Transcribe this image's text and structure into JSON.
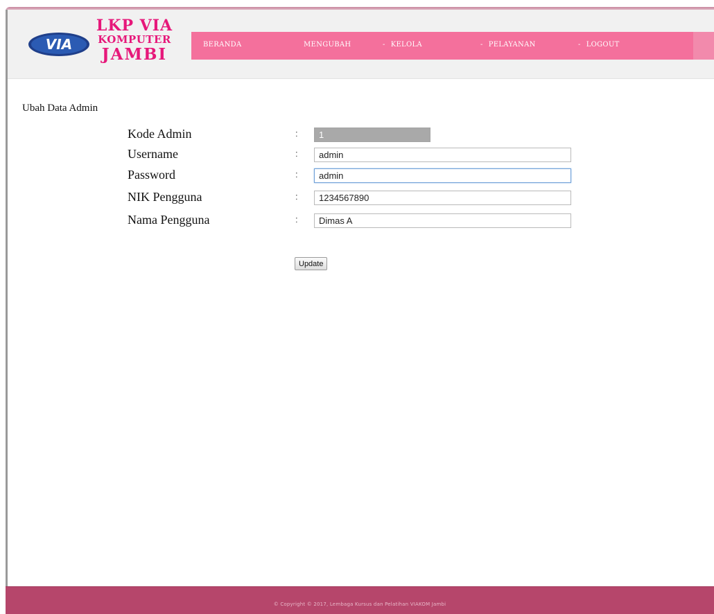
{
  "header": {
    "logo": {
      "badge_text": "VIA",
      "line1": "LKP VIA",
      "line2": "KOMPUTER",
      "line3": "JAMBI",
      "brand_color": "#e6187a"
    },
    "nav": {
      "accent": "#f4709c",
      "items": [
        {
          "label": "BERANDA",
          "caret": ""
        },
        {
          "label": "MENGUBAH",
          "caret": ""
        },
        {
          "label": "KELOLA",
          "caret": "-"
        },
        {
          "label": "PELAYANAN",
          "caret": "-"
        },
        {
          "label": "LOGOUT",
          "caret": "-"
        }
      ]
    }
  },
  "main": {
    "title": "Ubah Data Admin",
    "fields": [
      {
        "label": "Kode Admin",
        "colon": ":",
        "value": "1"
      },
      {
        "label": "Username",
        "colon": ":",
        "value": "admin"
      },
      {
        "label": "Password",
        "colon": ":",
        "value": "admin"
      },
      {
        "label": "NIK Pengguna",
        "colon": ":",
        "value": "1234567890"
      },
      {
        "label": "Nama Pengguna",
        "colon": ":",
        "value": "Dimas A"
      }
    ],
    "update_label": "Update"
  },
  "footer": {
    "copyright": "© Copyright © 2017, Lembaga Kursus dan Pelatihan VIAKOM Jambi",
    "color": "#b6466b"
  }
}
